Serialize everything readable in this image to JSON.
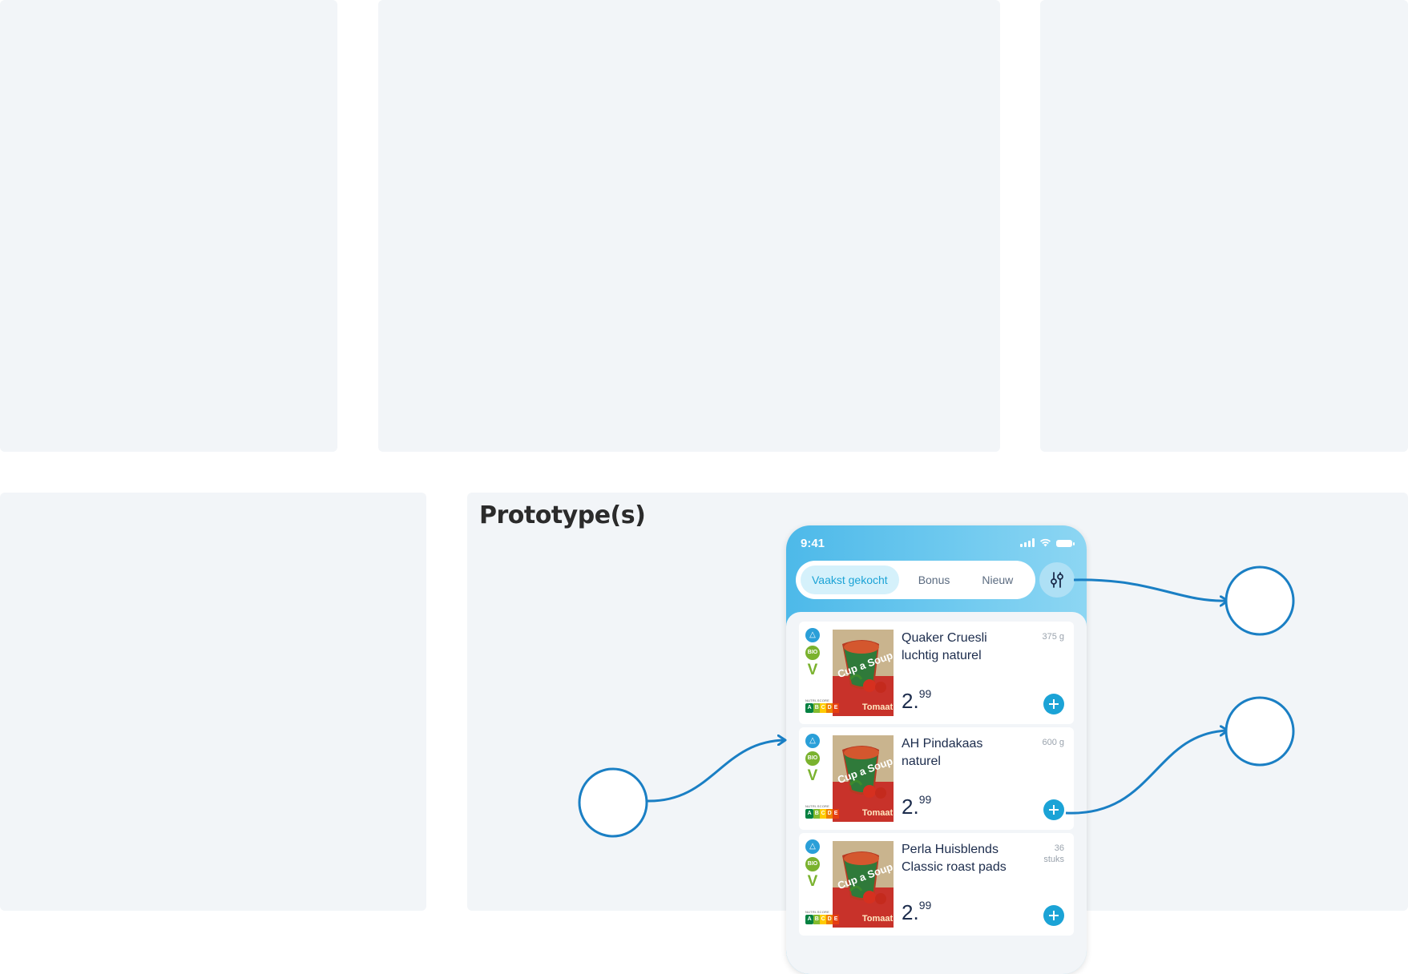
{
  "section": {
    "title": "Prototype(s)"
  },
  "status_bar": {
    "time": "9:41"
  },
  "tabs": [
    {
      "label": "Vaakst gekocht",
      "active": true
    },
    {
      "label": "Bonus",
      "active": false
    },
    {
      "label": "Nieuw",
      "active": false
    }
  ],
  "products": [
    {
      "name": "Quaker Cruesli luchtig naturel",
      "unit": "375 g",
      "price_main": "2.",
      "price_cents": "99"
    },
    {
      "name": "AH Pindakaas naturel",
      "unit": "600 g",
      "price_main": "2.",
      "price_cents": "99"
    },
    {
      "name": "Perla Huisblends Classic roast pads",
      "unit": "36 stuks",
      "price_main": "2.",
      "price_cents": "99"
    }
  ],
  "product_image": {
    "brand": "Cup a Soup",
    "flavor": "Tomaat"
  },
  "badges": {
    "bio": "BIO",
    "vegan": "V",
    "nutri_label": "NUTRI-SCORE",
    "nutri_letters": [
      "A",
      "B",
      "C",
      "D",
      "E"
    ]
  },
  "icons": [
    "wifi-icon",
    "signal-icon",
    "battery-icon",
    "filter-sliders-icon",
    "plus-icon"
  ],
  "colors": {
    "accent": "#1ba3d6",
    "annotation": "#1a7fc4",
    "panel": "#f2f5f8",
    "text": "#1c2c4c"
  }
}
